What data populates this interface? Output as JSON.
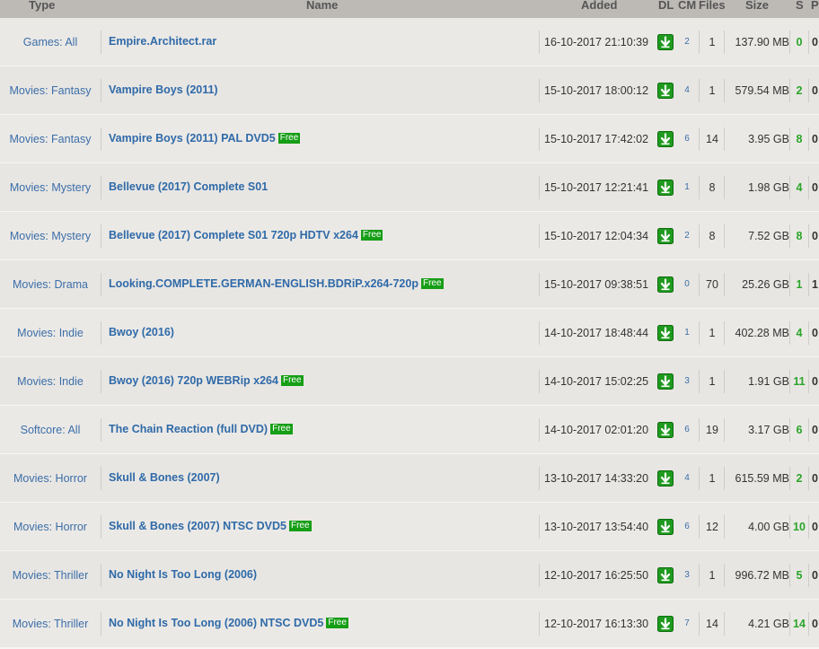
{
  "columns": {
    "type": "Type",
    "name": "Name",
    "added": "Added",
    "dl": "DL",
    "cm": "CM",
    "files": "Files",
    "size": "Size",
    "seeds": "S",
    "peers": "P"
  },
  "free_label": "Free",
  "colors": {
    "free_badge": "#169e16",
    "link": "#2f6aa8",
    "seeds": "#2aa52a"
  },
  "rows": [
    {
      "type": "Games: All",
      "name": "Empire.Architect.rar",
      "free": false,
      "added": "16-10-2017 21:10:39",
      "cm": "2",
      "files": "1",
      "size": "137.90 MB",
      "seeds": "0",
      "peers": "0"
    },
    {
      "type": "Movies: Fantasy",
      "name": "Vampire Boys (2011)",
      "free": false,
      "added": "15-10-2017 18:00:12",
      "cm": "4",
      "files": "1",
      "size": "579.54 MB",
      "seeds": "2",
      "peers": "0"
    },
    {
      "type": "Movies: Fantasy",
      "name": "Vampire Boys (2011) PAL DVD5",
      "free": true,
      "added": "15-10-2017 17:42:02",
      "cm": "6",
      "files": "14",
      "size": "3.95 GB",
      "seeds": "8",
      "peers": "0"
    },
    {
      "type": "Movies: Mystery",
      "name": "Bellevue (2017) Complete S01",
      "free": false,
      "added": "15-10-2017 12:21:41",
      "cm": "1",
      "files": "8",
      "size": "1.98 GB",
      "seeds": "4",
      "peers": "0"
    },
    {
      "type": "Movies: Mystery",
      "name": "Bellevue (2017) Complete S01 720p HDTV x264",
      "free": true,
      "added": "15-10-2017 12:04:34",
      "cm": "2",
      "files": "8",
      "size": "7.52 GB",
      "seeds": "8",
      "peers": "0"
    },
    {
      "type": "Movies: Drama",
      "name": "Looking.COMPLETE.GERMAN-ENGLISH.BDRiP.x264-720p",
      "free": true,
      "added": "15-10-2017 09:38:51",
      "cm": "0",
      "files": "70",
      "size": "25.26 GB",
      "seeds": "1",
      "peers": "1"
    },
    {
      "type": "Movies: Indie",
      "name": "Bwoy (2016)",
      "free": false,
      "added": "14-10-2017 18:48:44",
      "cm": "1",
      "files": "1",
      "size": "402.28 MB",
      "seeds": "4",
      "peers": "0"
    },
    {
      "type": "Movies: Indie",
      "name": "Bwoy (2016) 720p WEBRip x264",
      "free": true,
      "added": "14-10-2017 15:02:25",
      "cm": "3",
      "files": "1",
      "size": "1.91 GB",
      "seeds": "11",
      "peers": "0"
    },
    {
      "type": "Softcore: All",
      "name": "The Chain Reaction (full DVD)",
      "free": true,
      "added": "14-10-2017 02:01:20",
      "cm": "6",
      "files": "19",
      "size": "3.17 GB",
      "seeds": "6",
      "peers": "0"
    },
    {
      "type": "Movies: Horror",
      "name": "Skull & Bones (2007)",
      "free": false,
      "added": "13-10-2017 14:33:20",
      "cm": "4",
      "files": "1",
      "size": "615.59 MB",
      "seeds": "2",
      "peers": "0"
    },
    {
      "type": "Movies: Horror",
      "name": "Skull & Bones (2007) NTSC DVD5",
      "free": true,
      "added": "13-10-2017 13:54:40",
      "cm": "6",
      "files": "12",
      "size": "4.00 GB",
      "seeds": "10",
      "peers": "0"
    },
    {
      "type": "Movies: Thriller",
      "name": "No Night Is Too Long (2006)",
      "free": false,
      "added": "12-10-2017 16:25:50",
      "cm": "3",
      "files": "1",
      "size": "996.72 MB",
      "seeds": "5",
      "peers": "0"
    },
    {
      "type": "Movies: Thriller",
      "name": "No Night Is Too Long (2006) NTSC DVD5",
      "free": true,
      "added": "12-10-2017 16:13:30",
      "cm": "7",
      "files": "14",
      "size": "4.21 GB",
      "seeds": "14",
      "peers": "0"
    }
  ]
}
